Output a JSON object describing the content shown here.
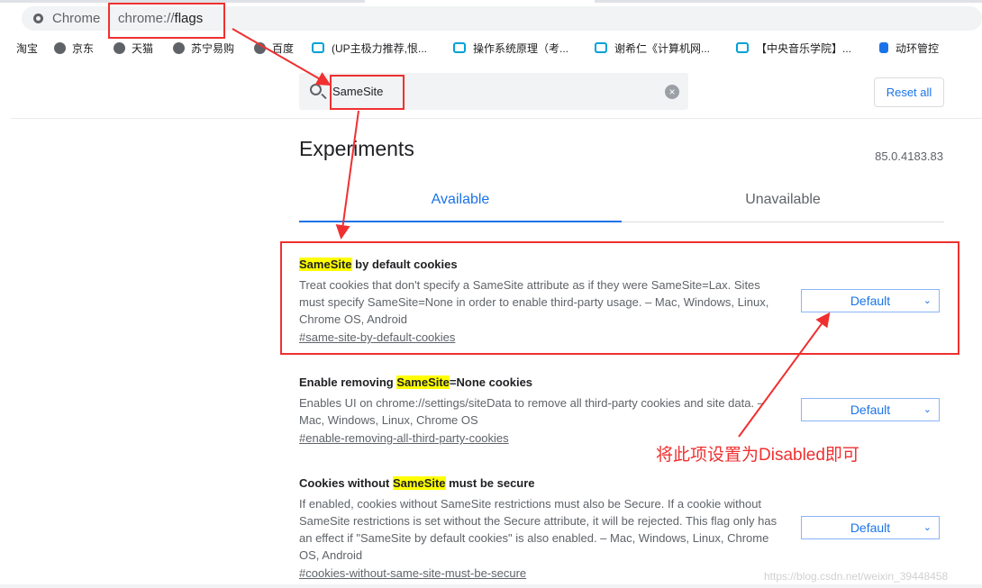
{
  "browser": {
    "chip_label": "Chrome",
    "url_scheme": "chrome://",
    "url_host": "flags"
  },
  "bookmarks": [
    {
      "label": "淘宝",
      "icon": "none"
    },
    {
      "label": "京东",
      "icon": "globe-icon"
    },
    {
      "label": "天猫",
      "icon": "globe-icon"
    },
    {
      "label": "苏宁易购",
      "icon": "globe-icon"
    },
    {
      "label": "百度",
      "icon": "globe-icon"
    },
    {
      "label": "(UP主极力推荐,恨...",
      "icon": "bilibili-icon"
    },
    {
      "label": "操作系统原理（考...",
      "icon": "bilibili-icon"
    },
    {
      "label": "谢希仁《计算机网...",
      "icon": "bilibili-icon"
    },
    {
      "label": "【中央音乐学院】...",
      "icon": "bilibili-icon"
    },
    {
      "label": "动环管控",
      "icon": "app-icon"
    }
  ],
  "search": {
    "value": "SameSite",
    "reset_label": "Reset all"
  },
  "page": {
    "title": "Experiments",
    "version": "85.0.4183.83"
  },
  "tabs": [
    {
      "label": "Available",
      "selected": true
    },
    {
      "label": "Unavailable",
      "selected": false
    }
  ],
  "flags": [
    {
      "title_pre": "",
      "title_hl": "SameSite",
      "title_post": " by default cookies",
      "description": "Treat cookies that don't specify a SameSite attribute as if they were SameSite=Lax. Sites must specify SameSite=None in order to enable third-party usage. – Mac, Windows, Linux, Chrome OS, Android",
      "anchor": "#same-site-by-default-cookies",
      "value": "Default"
    },
    {
      "title_pre": "Enable removing ",
      "title_hl": "SameSite",
      "title_post": "=None cookies",
      "description": "Enables UI on chrome://settings/siteData to remove all third-party cookies and site data. – Mac, Windows, Linux, Chrome OS",
      "anchor": "#enable-removing-all-third-party-cookies",
      "value": "Default"
    },
    {
      "title_pre": "Cookies without ",
      "title_hl": "SameSite",
      "title_post": " must be secure",
      "description": "If enabled, cookies without SameSite restrictions must also be Secure. If a cookie without SameSite restrictions is set without the Secure attribute, it will be rejected. This flag only has an effect if \"SameSite by default cookies\" is also enabled. – Mac, Windows, Linux, Chrome OS, Android",
      "anchor": "#cookies-without-same-site-must-be-secure",
      "value": "Default"
    }
  ],
  "annotation": {
    "note": "将此项设置为Disabled即可",
    "color": "#f03030"
  },
  "watermark": "https://blog.csdn.net/weixin_39448458"
}
